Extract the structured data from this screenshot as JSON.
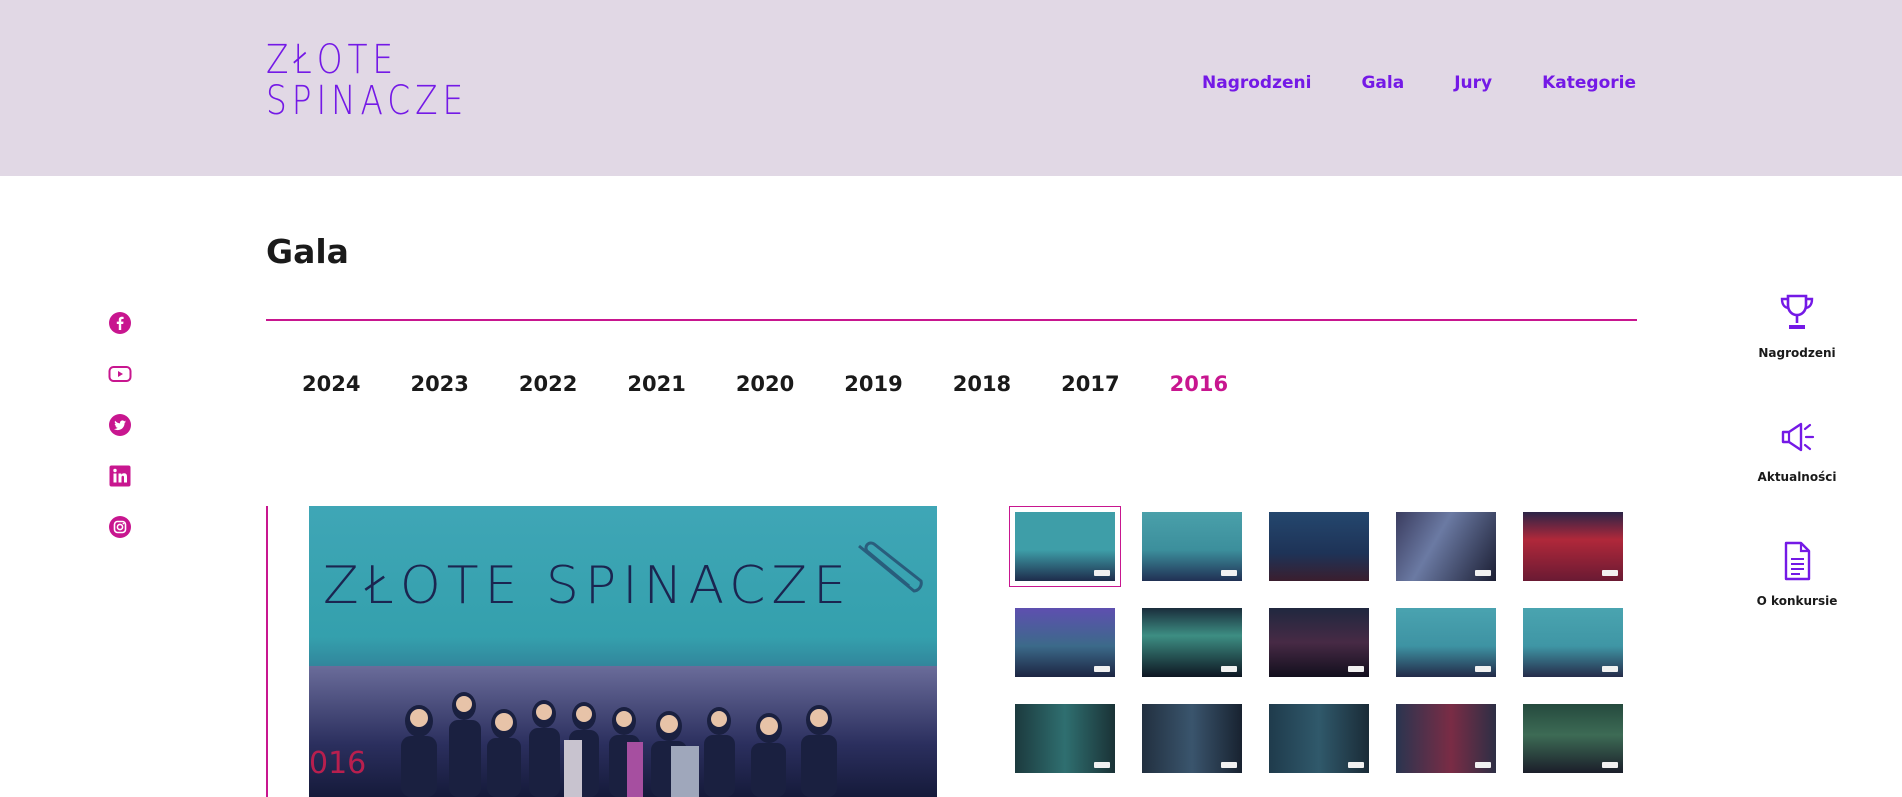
{
  "header": {
    "logo_line1": "ZŁOTE",
    "logo_line2": "SPINACZE",
    "nav": [
      "Nagrodzeni",
      "Gala",
      "Jury",
      "Kategorie"
    ]
  },
  "page": {
    "title": "Gala"
  },
  "years": {
    "items": [
      "2024",
      "2023",
      "2022",
      "2021",
      "2020",
      "2019",
      "2018",
      "2017",
      "2016"
    ],
    "active": "2016"
  },
  "social": [
    "facebook-icon",
    "youtube-icon",
    "twitter-icon",
    "linkedin-icon",
    "instagram-icon"
  ],
  "main_photo": {
    "screen_text": "ZŁOTE SPINACZE",
    "year_mark": "016"
  },
  "gallery": {
    "count": 15,
    "selected_index": 0
  },
  "sidebar": {
    "items": [
      {
        "label": "Nagrodzeni",
        "icon": "trophy-icon"
      },
      {
        "label": "Aktualności",
        "icon": "megaphone-icon"
      },
      {
        "label": "O konkursie",
        "icon": "document-icon"
      }
    ]
  },
  "colors": {
    "accent": "#7419e6",
    "brand_pink": "#c8168f",
    "header_bg": "#e1d8e5"
  }
}
